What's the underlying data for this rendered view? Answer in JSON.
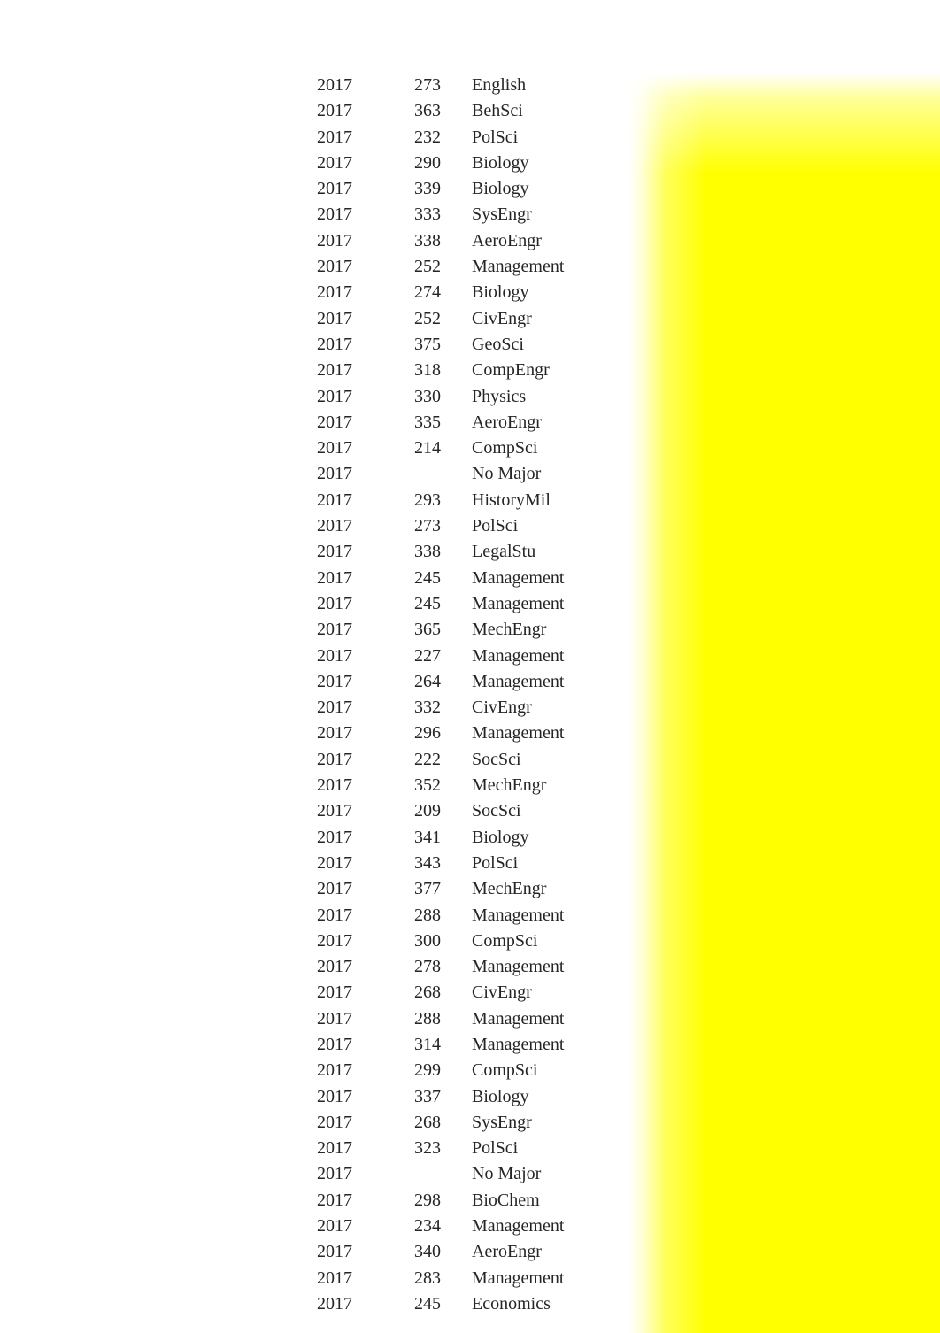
{
  "rows": [
    {
      "year": "2017",
      "num": "273",
      "major": "English"
    },
    {
      "year": "2017",
      "num": "363",
      "major": "BehSci"
    },
    {
      "year": "2017",
      "num": "232",
      "major": "PolSci"
    },
    {
      "year": "2017",
      "num": "290",
      "major": "Biology"
    },
    {
      "year": "2017",
      "num": "339",
      "major": "Biology"
    },
    {
      "year": "2017",
      "num": "333",
      "major": "SysEngr"
    },
    {
      "year": "2017",
      "num": "338",
      "major": "AeroEngr"
    },
    {
      "year": "2017",
      "num": "252",
      "major": "Management"
    },
    {
      "year": "2017",
      "num": "274",
      "major": "Biology"
    },
    {
      "year": "2017",
      "num": "252",
      "major": "CivEngr"
    },
    {
      "year": "2017",
      "num": "375",
      "major": "GeoSci"
    },
    {
      "year": "2017",
      "num": "318",
      "major": "CompEngr"
    },
    {
      "year": "2017",
      "num": "330",
      "major": "Physics"
    },
    {
      "year": "2017",
      "num": "335",
      "major": "AeroEngr"
    },
    {
      "year": "2017",
      "num": "214",
      "major": "CompSci"
    },
    {
      "year": "2017",
      "num": "",
      "major": "No Major"
    },
    {
      "year": "2017",
      "num": "293",
      "major": "HistoryMil"
    },
    {
      "year": "2017",
      "num": "273",
      "major": "PolSci"
    },
    {
      "year": "2017",
      "num": "338",
      "major": "LegalStu"
    },
    {
      "year": "2017",
      "num": "245",
      "major": "Management"
    },
    {
      "year": "2017",
      "num": "245",
      "major": "Management"
    },
    {
      "year": "2017",
      "num": "365",
      "major": "MechEngr"
    },
    {
      "year": "2017",
      "num": "227",
      "major": "Management"
    },
    {
      "year": "2017",
      "num": "264",
      "major": "Management"
    },
    {
      "year": "2017",
      "num": "332",
      "major": "CivEngr"
    },
    {
      "year": "2017",
      "num": "296",
      "major": "Management"
    },
    {
      "year": "2017",
      "num": "222",
      "major": "SocSci"
    },
    {
      "year": "2017",
      "num": "352",
      "major": "MechEngr"
    },
    {
      "year": "2017",
      "num": "209",
      "major": "SocSci"
    },
    {
      "year": "2017",
      "num": "341",
      "major": "Biology"
    },
    {
      "year": "2017",
      "num": "343",
      "major": "PolSci"
    },
    {
      "year": "2017",
      "num": "377",
      "major": "MechEngr"
    },
    {
      "year": "2017",
      "num": "288",
      "major": "Management"
    },
    {
      "year": "2017",
      "num": "300",
      "major": "CompSci"
    },
    {
      "year": "2017",
      "num": "278",
      "major": "Management"
    },
    {
      "year": "2017",
      "num": "268",
      "major": "CivEngr"
    },
    {
      "year": "2017",
      "num": "288",
      "major": "Management"
    },
    {
      "year": "2017",
      "num": "314",
      "major": "Management"
    },
    {
      "year": "2017",
      "num": "299",
      "major": "CompSci"
    },
    {
      "year": "2017",
      "num": "337",
      "major": "Biology"
    },
    {
      "year": "2017",
      "num": "268",
      "major": "SysEngr"
    },
    {
      "year": "2017",
      "num": "323",
      "major": "PolSci"
    },
    {
      "year": "2017",
      "num": "",
      "major": "No Major"
    },
    {
      "year": "2017",
      "num": "298",
      "major": "BioChem"
    },
    {
      "year": "2017",
      "num": "234",
      "major": "Management"
    },
    {
      "year": "2017",
      "num": "340",
      "major": "AeroEngr"
    },
    {
      "year": "2017",
      "num": "283",
      "major": "Management"
    },
    {
      "year": "2017",
      "num": "245",
      "major": "Economics"
    }
  ]
}
